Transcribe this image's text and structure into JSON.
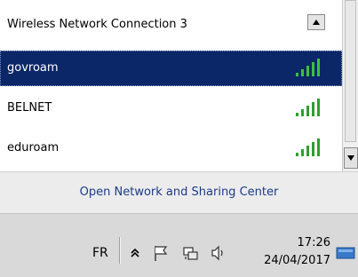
{
  "popup": {
    "section_header": "Wireless Network Connection 3",
    "networks": [
      {
        "name": "govroam",
        "signal_bars": 5,
        "selected": true
      },
      {
        "name": "BELNET",
        "signal_bars": 5,
        "selected": false
      },
      {
        "name": "eduroam",
        "signal_bars": 5,
        "selected": false
      }
    ],
    "footer_link": "Open Network and Sharing Center"
  },
  "taskbar": {
    "language": "FR",
    "time": "17:26",
    "date": "24/04/2017",
    "tray_icons": [
      "show-hidden-icons",
      "action-center-flag-icon",
      "network-icon",
      "volume-icon"
    ]
  },
  "colors": {
    "selection": "#0b2768",
    "link": "#1c3a87",
    "signal_green": "#2e9e2e"
  }
}
